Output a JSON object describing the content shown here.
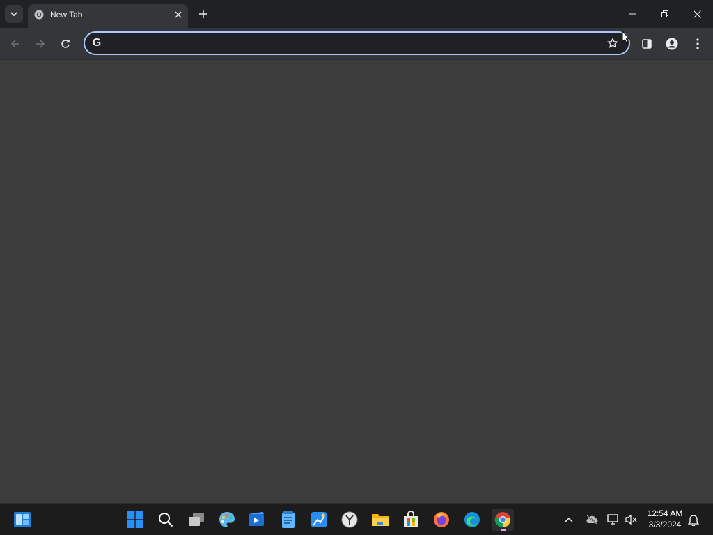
{
  "browser": {
    "tab": {
      "title": "New Tab"
    },
    "omnibox": {
      "value": "",
      "placeholder": ""
    }
  },
  "icons": {
    "tab_search": "chevron-down-icon",
    "favicon": "chrome-icon",
    "tab_close": "close-icon",
    "new_tab": "plus-icon",
    "minimize": "minimize-icon",
    "restore": "restore-icon",
    "close": "close-icon",
    "back": "arrow-left-icon",
    "forward": "arrow-right-icon",
    "reload": "reload-icon",
    "search_engine": "google-icon",
    "bookmark": "star-icon",
    "side_panel": "side-panel-icon",
    "profile": "person-icon",
    "menu": "kebab-menu-icon"
  },
  "taskbar": {
    "apps": [
      {
        "name": "widgets"
      },
      {
        "name": "start"
      },
      {
        "name": "search"
      },
      {
        "name": "task-view"
      },
      {
        "name": "photos-editor"
      },
      {
        "name": "video-editor"
      },
      {
        "name": "notepad"
      },
      {
        "name": "paint"
      },
      {
        "name": "clock"
      },
      {
        "name": "file-explorer"
      },
      {
        "name": "microsoft-store"
      },
      {
        "name": "firefox"
      },
      {
        "name": "edge"
      },
      {
        "name": "chrome",
        "active": true
      }
    ],
    "clock": {
      "time": "12:54 AM",
      "date": "3/3/2024"
    }
  },
  "colors": {
    "tabstrip": "#202124",
    "toolbar": "#35363a",
    "content": "#3c3c3c",
    "focus_ring": "#a8c7fa",
    "taskbar": "#1c1c1c"
  }
}
